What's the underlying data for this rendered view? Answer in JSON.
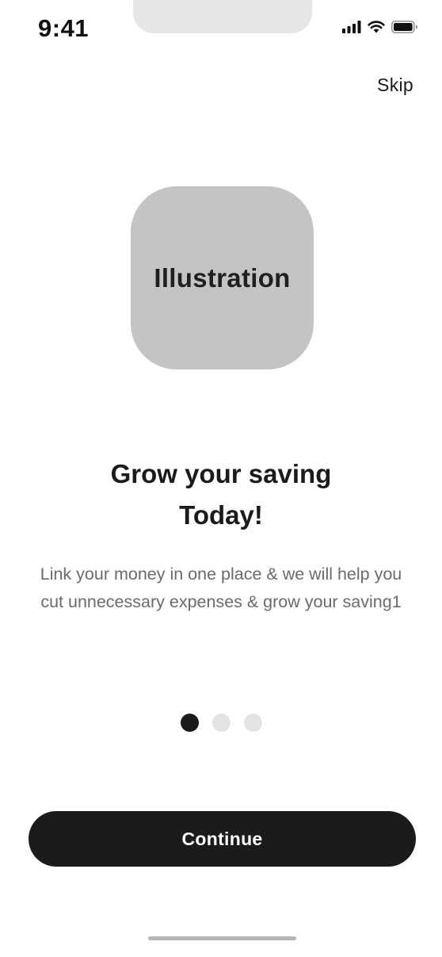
{
  "status_bar": {
    "time": "9:41",
    "icons": [
      "cellular-signal-icon",
      "wifi-icon",
      "battery-icon"
    ]
  },
  "header": {
    "skip_label": "Skip"
  },
  "illustration": {
    "label": "Illustration",
    "color": "#c4c4c4"
  },
  "content": {
    "title_line1": "Grow your saving",
    "title_line2": "Today!",
    "description": "Link your money in one place & we will help you cut unnecessary expenses & grow your saving1"
  },
  "pagination": {
    "total": 3,
    "current": 1
  },
  "actions": {
    "continue_label": "Continue"
  },
  "colors": {
    "primary": "#1b1b1b",
    "text_muted": "#6b6b6b",
    "dot_inactive": "#e3e3e3",
    "background": "#ffffff"
  }
}
